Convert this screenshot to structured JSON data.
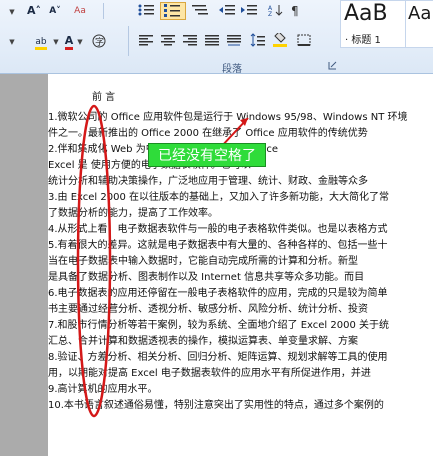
{
  "ribbon": {
    "font_group": {
      "grow_font": "A˄",
      "shrink_font": "A˅",
      "clear_format": "Aa",
      "bullet_a": "abc",
      "font_color": "A",
      "highlight": "ab"
    },
    "paragraph_label": "段落",
    "styles": {
      "quick_style_1_preview": "AaB",
      "quick_style_1_label": "· 标题 1",
      "quick_style_2_preview": "Aa"
    },
    "colors": {
      "highlight": "#fde6a6",
      "font_red": "#d62020",
      "highlight_yellow": "#ffd200"
    }
  },
  "callout": {
    "text": "已经没有空格了"
  },
  "document": {
    "heading": "前    言",
    "lines": [
      "1.微软公司的 Office 应用软件包是运行于 Windows 95/98、Windows NT 环境",
      "    件之一。最新推出的 Office 2000 在继承了 Office 应用软件的传统优势",
      "2.伴和集成化                       Web 为中心的新环境中。作为 Office",
      "    Excel 是                       使用方便的电子数据表软件。它可以",
      "    统计分析和辅助决策操作，广泛地应用于管理、统计、财政、金融等众多",
      "3.由 Excel 2000 在以往版本的基础上，又加入了许多新功能，大大简化了常",
      "    了数据分析的能力，提高了工作效率。",
      "4.从形式上看，电子数据表软件与一般的电子表格软件类似。也是以表格方式",
      "5.有着很大的差异。这就是电子数据表中有大量的、各种各样的、包括一些十",
      "    当在电子数据表中输入数据时，它能自动完成所需的计算和分析。新型",
      "    是具备了数据分析、图表制作以及 Internet 信息共享等众多功能。而目",
      "6.电子数据表的应用还停留在一般电子表格软件的应用，完成的只是较为简单",
      "    书主要通过经营分析、透视分析、敏感分析、风险分析、统计分析、投资",
      "7.和股市行情分析等若干案例，较为系统、全面地介绍了 Excel 2000 关于统",
      "    汇总、合并计算和数据透视表的操作，模拟运算表、单变量求解、方案",
      "8.验证、方差分析、相关分析、回归分析、矩阵运算、规划求解等工具的使用",
      "    用，以期能对提高 Excel 电子数据表软件的应用水平有所促进作用，并进",
      "9.高计算机的应用水平。",
      "10.本书语言叙述通俗易懂，特别注意突出了实用性的特点，通过多个案例的"
    ]
  }
}
